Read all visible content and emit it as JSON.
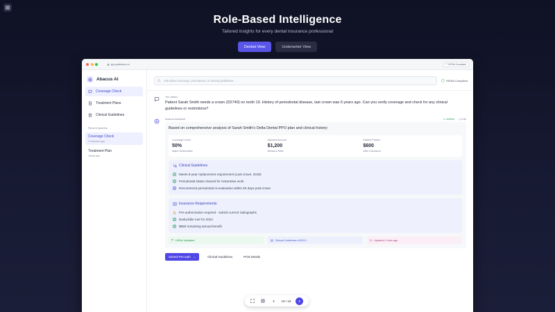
{
  "hero": {
    "title": "Role-Based Intelligence",
    "subtitle": "Tailored insights for every dental insurance professional",
    "views": [
      "Dentist View",
      "Underwriter View"
    ],
    "active_view": "Dentist View"
  },
  "window": {
    "url": "app.goabacus.co",
    "compliance": "HIPAA Compliant"
  },
  "sidebar": {
    "brand": "Abacus AI",
    "items": [
      {
        "label": "Coverage Check",
        "icon": "message-icon",
        "active": true
      },
      {
        "label": "Treatment Plans",
        "icon": "document-icon",
        "active": false
      },
      {
        "label": "Clinical Guidelines",
        "icon": "clipboard-icon",
        "active": false
      }
    ],
    "recent_label": "Recent Queries",
    "recent": [
      {
        "title": "Coverage Check",
        "time": "2 minutes ago",
        "active": true
      },
      {
        "title": "Treatment Plan",
        "time": "Yesterday",
        "active": false
      }
    ]
  },
  "main": {
    "search_placeholder": "Ask about coverage, procedures, or clinical guidelines...",
    "hipaa_badge": "HIPAA Compliant",
    "user_message": {
      "label": "You asked",
      "text": "Patient Sarah Smith needs a crown (D2740) on tooth 19. History of periodontal disease, last crown was 6 years ago. Can you verify coverage and check for any clinical guidelines or restrictions?"
    },
    "assistant": {
      "label": "Abacus Assistant",
      "verified": "Verified",
      "time": "0.8s",
      "intro": "Based on comprehensive analysis of Sarah Smith's Delta Dental PPO plan and clinical history:",
      "stats": [
        {
          "label": "Coverage Level",
          "value": "50%",
          "sub": "Major Restorative"
        },
        {
          "label": "Allowed Amount",
          "value": "$1,200",
          "sub": "Network Rate"
        },
        {
          "label": "Patient Portion",
          "value": "$600",
          "sub": "After Insurance"
        }
      ],
      "clinical": {
        "title": "Clinical Guidelines",
        "lines": [
          "Meets 5-year replacement requirement (Last crown: 2018)",
          "Periodontal status cleared for restorative work",
          "Recommend periodontal re-evaluation within 60 days post-crown"
        ]
      },
      "insurance": {
        "title": "Insurance Requirements",
        "lines": [
          {
            "text": "Pre-authorization required - submit current radiographs",
            "kind": "warning"
          },
          {
            "text": "Deductible met for 2024",
            "kind": "check"
          },
          {
            "text": "$850 remaining annual benefit",
            "kind": "check"
          }
        ]
      },
      "chips": [
        "HIPAA Validated",
        "Clinical Guidelines v2024.1",
        "Updated 2 mins ago"
      ]
    },
    "actions": {
      "primary": "Submit Pre-auth",
      "secondary": [
        "Clinical Guidelines",
        "Print Details"
      ]
    }
  },
  "pager": {
    "count": "19 / 19"
  }
}
